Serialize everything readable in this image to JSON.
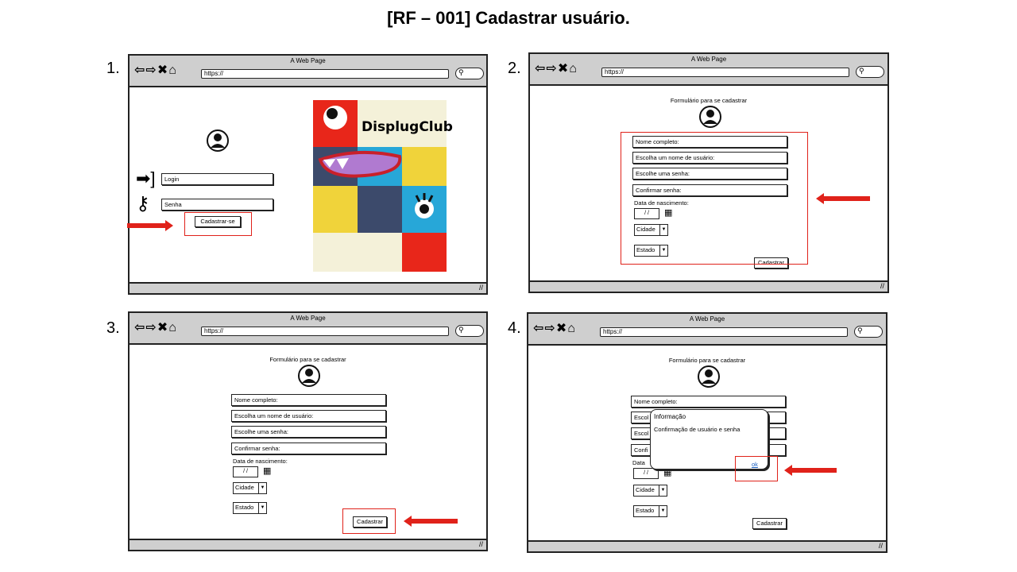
{
  "title": "[RF – 001] Cadastrar usuário.",
  "steps": [
    "1.",
    "2.",
    "3.",
    "4."
  ],
  "browser": {
    "window_title": "A Web Page",
    "url": "https://"
  },
  "login": {
    "login_placeholder": "Login",
    "password_placeholder": "Senha",
    "register_button": "Cadastrar-se",
    "logo_text": "DisplugClub"
  },
  "form": {
    "heading": "Formulário para se cadastrar",
    "full_name": "Nome completo:",
    "username": "Escolha um nome de usuário:",
    "password": "Escolhe uma senha:",
    "confirm_password": "Confirmar senha:",
    "birth_label": "Data de nascimento:",
    "date_value": "/ /",
    "city": "Cidade",
    "state": "Estado",
    "submit": "Cadastrar"
  },
  "dialog": {
    "title": "Informação",
    "message": "Confirmação de usuário e senha",
    "ok": "ok",
    "partial": [
      "Escol",
      "Escol",
      "Confi",
      "Data"
    ]
  },
  "colors": {
    "highlight": "#e0221a",
    "chrome": "#cfcfcf",
    "logo_red": "#e8261a",
    "logo_cream": "#f4f1d9",
    "logo_yellow": "#f0d33a",
    "logo_navy": "#3c4a6b",
    "logo_blue": "#27a7d8"
  }
}
